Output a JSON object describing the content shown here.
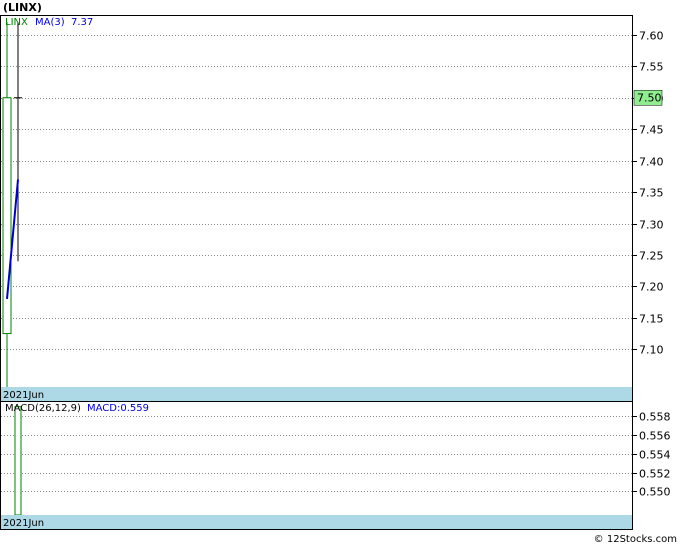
{
  "title": "(LINX)",
  "footer": "© 12Stocks.com",
  "price_panel": {
    "legend_ticker": "LINX",
    "legend_ma_label": "MA(3)",
    "legend_ma_value": "7.37",
    "last_price_label": "7.50",
    "date_label": "2021Jun"
  },
  "macd_panel": {
    "legend_label": "MACD(26,12,9)",
    "legend_value": "MACD:0.559",
    "date_label": "2021Jun"
  },
  "colors": {
    "ticker": "#008000",
    "ma_line": "#0000cc",
    "macd_bar": "#008000",
    "date_band": "#add8e6",
    "last_price_bg": "#90ee90"
  },
  "chart_data": [
    {
      "type": "candlestick",
      "ylim": [
        7.04,
        7.63
      ],
      "yticks": [
        "7.60",
        "7.55",
        "7.50",
        "7.45",
        "7.40",
        "7.35",
        "7.30",
        "7.25",
        "7.20",
        "7.15",
        "7.10"
      ],
      "candles": [
        {
          "open": 7.125,
          "close": 7.5,
          "high": 7.62,
          "low": 7.04,
          "color": "green"
        },
        {
          "open": 7.5,
          "close": 7.5,
          "high": 7.62,
          "low": 7.24,
          "color": "black"
        }
      ],
      "ma3": [
        7.18,
        7.37
      ]
    },
    {
      "type": "bar",
      "ylim": [
        0.5475,
        0.5595
      ],
      "yticks": [
        "0.558",
        "0.556",
        "0.554",
        "0.552",
        "0.550"
      ],
      "values": [
        0.559
      ]
    }
  ]
}
